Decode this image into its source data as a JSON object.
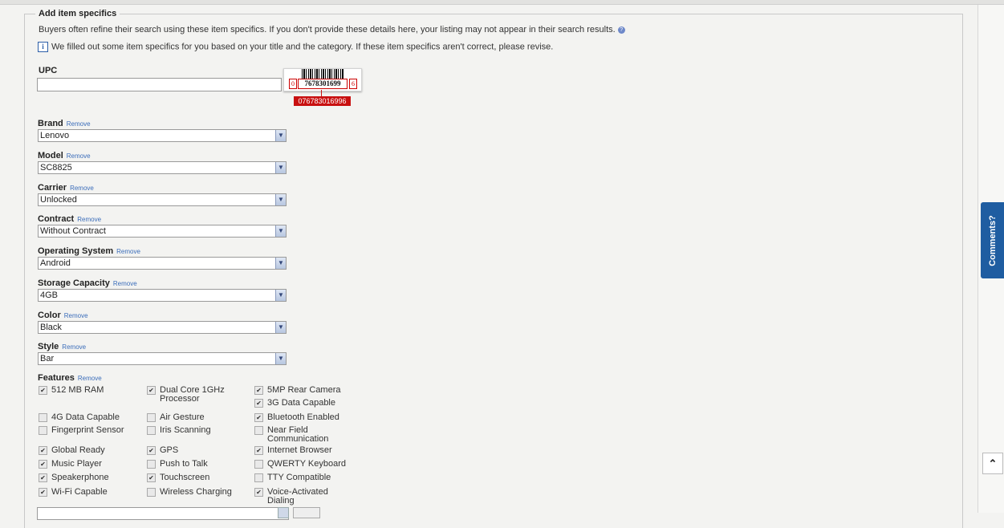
{
  "section": {
    "legend": "Add item specifics",
    "help_text": "Buyers often refine their search using these item specifics. If you don't provide these details here, your listing may not appear in their search results.",
    "info_text": "We filled out some item specifics for you based on your title and the category. If these item specifics aren't correct, please revise."
  },
  "upc": {
    "label": "UPC",
    "value": "",
    "barcode_left": "0",
    "barcode_number": "7678301699",
    "barcode_right": "6",
    "barcode_tag": "076783016996"
  },
  "remove_label": "Remove",
  "fields": [
    {
      "label": "Brand",
      "value": "Lenovo"
    },
    {
      "label": "Model",
      "value": "SC8825"
    },
    {
      "label": "Carrier",
      "value": "Unlocked"
    },
    {
      "label": "Contract",
      "value": "Without Contract"
    },
    {
      "label": "Operating System",
      "value": "Android"
    },
    {
      "label": "Storage Capacity",
      "value": "4GB"
    },
    {
      "label": "Color",
      "value": "Black"
    },
    {
      "label": "Style",
      "value": "Bar"
    }
  ],
  "features": {
    "label": "Features",
    "items": [
      {
        "label": "512 MB RAM",
        "checked": true
      },
      {
        "label": "Dual Core 1GHz Processor",
        "checked": true
      },
      {
        "label": "5MP Rear Camera",
        "checked": true
      },
      {
        "label": "3G Data Capable",
        "checked": true
      },
      {
        "label": "4G Data Capable",
        "checked": false
      },
      {
        "label": "Air Gesture",
        "checked": false
      },
      {
        "label": "Bluetooth Enabled",
        "checked": true
      },
      {
        "label": "Fingerprint Sensor",
        "checked": false
      },
      {
        "label": "Iris Scanning",
        "checked": false
      },
      {
        "label": "Near Field Communication",
        "checked": false
      },
      {
        "label": "Global Ready",
        "checked": true
      },
      {
        "label": "GPS",
        "checked": true
      },
      {
        "label": "Internet Browser",
        "checked": true
      },
      {
        "label": "Music Player",
        "checked": true
      },
      {
        "label": "Push to Talk",
        "checked": false
      },
      {
        "label": "QWERTY Keyboard",
        "checked": false
      },
      {
        "label": "Speakerphone",
        "checked": true
      },
      {
        "label": "Touchscreen",
        "checked": true
      },
      {
        "label": "TTY Compatible",
        "checked": false
      },
      {
        "label": "Wi-Fi Capable",
        "checked": true
      },
      {
        "label": "Wireless Charging",
        "checked": false
      },
      {
        "label": "Voice-Activated Dialing",
        "checked": true
      }
    ]
  },
  "side": {
    "comments_label": "Comments?",
    "scroll_top_icon": "chevron-up-icon"
  },
  "colors": {
    "accent": "#1f5da1",
    "barcode_red": "#c81010",
    "link": "#3b6dba"
  }
}
